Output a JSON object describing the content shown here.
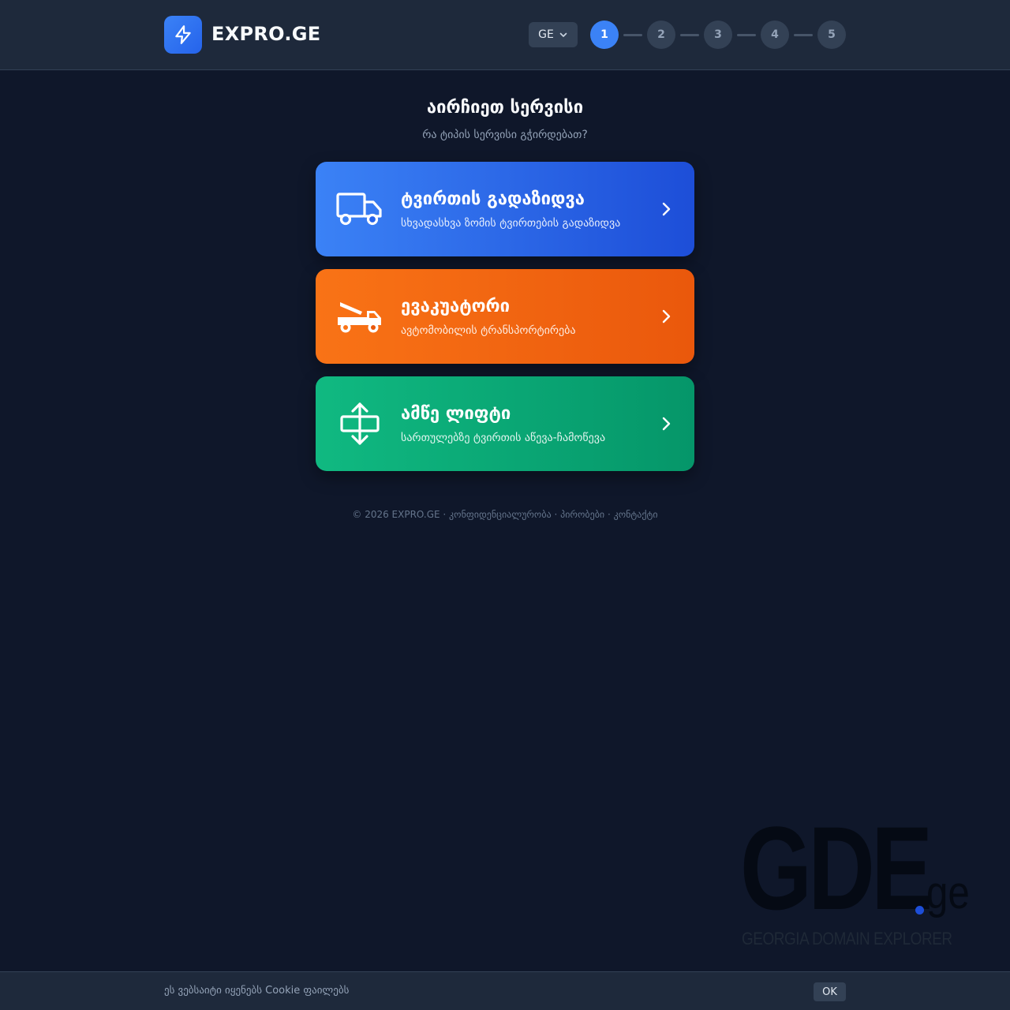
{
  "header": {
    "logo_text": "EXPRO.GE",
    "logo_icon": "lightning-bolt-icon",
    "language": "GE",
    "steps": [
      "1",
      "2",
      "3",
      "4",
      "5"
    ],
    "active_step": "1"
  },
  "main": {
    "title": "აირჩიეთ სერვისი",
    "subtitle": "რა ტიპის სერვისი გჭირდებათ?",
    "services": [
      {
        "title": "ტვირთის გადაზიდვა",
        "description": "სხვადასხვა ზომის ტვირთების გადაზიდვა",
        "icon": "truck-icon",
        "color": "#3b82f6"
      },
      {
        "title": "ევაკუატორი",
        "description": "ავტომობილის ტრანსპორტირება",
        "icon": "tow-truck-icon",
        "color": "#f97316"
      },
      {
        "title": "ამწე ლიფტი",
        "description": "სართულებზე ტვირთის აწევა-ჩამოწევა",
        "icon": "move-vertical-icon",
        "color": "#10b981"
      }
    ]
  },
  "footer": {
    "copyright": "© 2026 EXPRO.GE",
    "links": [
      "კონფიდენციალურობა",
      "პირობები",
      "კონტაქტი"
    ]
  },
  "watermark": {
    "brand": "GDE",
    "tld": "ge",
    "tagline": "GEORGIA DOMAIN EXPLORER"
  },
  "cookie": {
    "text": "ეს ვებსაიტი იყენებს Cookie ფაილებს",
    "ok_label": "OK"
  }
}
